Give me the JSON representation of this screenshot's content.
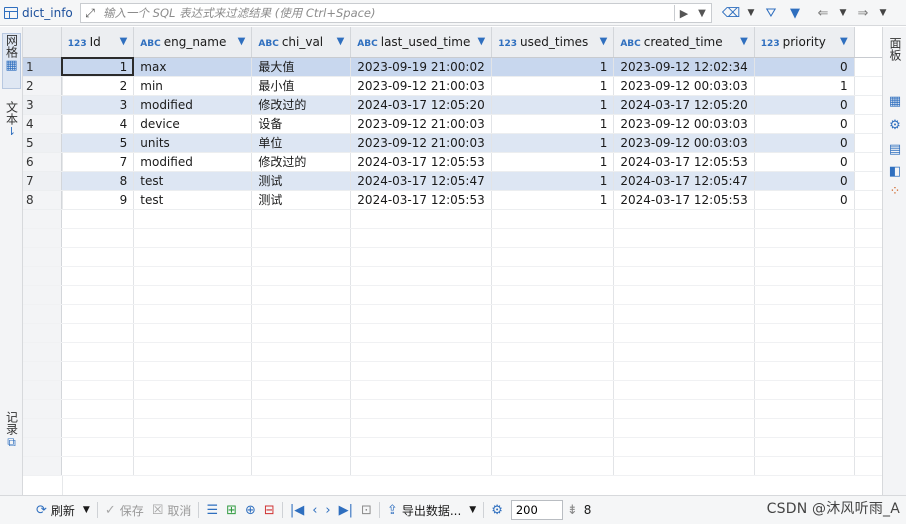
{
  "top_bar": {
    "table_name": "dict_info",
    "filter_placeholder": "输入一个 SQL 表达式来过滤结果 (使用 Ctrl+Space)"
  },
  "left_panel": {
    "tabs": [
      {
        "label": "网格",
        "active": true
      },
      {
        "label": "文本",
        "active": false
      },
      {
        "label": "记录",
        "active": false
      }
    ]
  },
  "right_panel": {
    "label": "面板"
  },
  "grid": {
    "columns": [
      {
        "type": "123",
        "name": "Id"
      },
      {
        "type": "ABC",
        "name": "eng_name"
      },
      {
        "type": "ABC",
        "name": "chi_val"
      },
      {
        "type": "ABC",
        "name": "last_used_time"
      },
      {
        "type": "123",
        "name": "used_times"
      },
      {
        "type": "ABC",
        "name": "created_time"
      },
      {
        "type": "123",
        "name": "priority"
      }
    ],
    "rows": [
      {
        "n": "1",
        "cells": [
          "1",
          "max",
          "最大值",
          "2023-09-19 21:00:02",
          "1",
          "2023-09-12 12:02:34",
          "0"
        ]
      },
      {
        "n": "2",
        "cells": [
          "2",
          "min",
          "最小值",
          "2023-09-12 21:00:03",
          "1",
          "2023-09-12 00:03:03",
          "1"
        ]
      },
      {
        "n": "3",
        "cells": [
          "3",
          "modified",
          "修改过的",
          "2024-03-17 12:05:20",
          "1",
          "2024-03-17 12:05:20",
          "0"
        ]
      },
      {
        "n": "4",
        "cells": [
          "4",
          "device",
          "设备",
          "2023-09-12 21:00:03",
          "1",
          "2023-09-12 00:03:03",
          "0"
        ]
      },
      {
        "n": "5",
        "cells": [
          "5",
          "units",
          "单位",
          "2023-09-12 21:00:03",
          "1",
          "2023-09-12 00:03:03",
          "0"
        ]
      },
      {
        "n": "6",
        "cells": [
          "7",
          "modified",
          "修改过的",
          "2024-03-17 12:05:53",
          "1",
          "2024-03-17 12:05:53",
          "0"
        ]
      },
      {
        "n": "7",
        "cells": [
          "8",
          "test",
          "测试",
          "2024-03-17 12:05:47",
          "1",
          "2024-03-17 12:05:47",
          "0"
        ]
      },
      {
        "n": "8",
        "cells": [
          "9",
          "test",
          "测试",
          "2024-03-17 12:05:53",
          "1",
          "2024-03-17 12:05:53",
          "0"
        ]
      }
    ]
  },
  "bottom_bar": {
    "refresh_label": "刷新",
    "save_label": "保存",
    "cancel_label": "取消",
    "export_label": "导出数据...",
    "fetch_size": "200",
    "row_count": "8"
  },
  "watermark": "CSDN @沐风听雨_A"
}
